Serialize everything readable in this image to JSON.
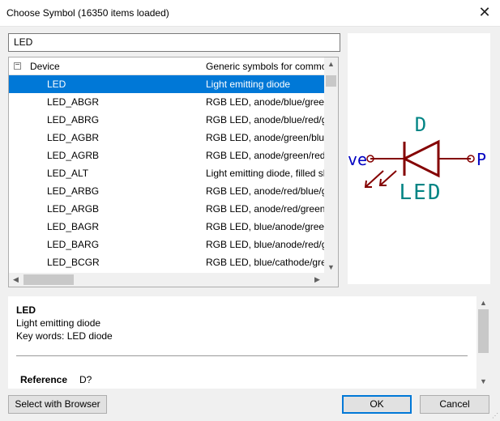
{
  "window": {
    "title": "Choose Symbol (16350 items loaded)"
  },
  "filter": {
    "value": "LED"
  },
  "tree": {
    "group": {
      "name": "Device",
      "description": "Generic symbols for common devices"
    },
    "rows": [
      {
        "name": "LED",
        "description": "Light emitting diode",
        "selected": true
      },
      {
        "name": "LED_ABGR",
        "description": "RGB LED, anode/blue/green/red"
      },
      {
        "name": "LED_ABRG",
        "description": "RGB LED, anode/blue/red/green"
      },
      {
        "name": "LED_AGBR",
        "description": "RGB LED, anode/green/blue/red"
      },
      {
        "name": "LED_AGRB",
        "description": "RGB LED, anode/green/red/blue"
      },
      {
        "name": "LED_ALT",
        "description": "Light emitting diode, filled shape"
      },
      {
        "name": "LED_ARBG",
        "description": "RGB LED, anode/red/blue/green"
      },
      {
        "name": "LED_ARGB",
        "description": "RGB LED, anode/red/green/blue"
      },
      {
        "name": "LED_BAGR",
        "description": "RGB LED, blue/anode/green/red"
      },
      {
        "name": "LED_BARG",
        "description": "RGB LED, blue/anode/red/green"
      },
      {
        "name": "LED_BCGR",
        "description": "RGB LED, blue/cathode/green/red"
      }
    ]
  },
  "preview": {
    "ref": "D",
    "value": "LED",
    "pin_left": "ve",
    "pin_right": "P",
    "body_color": "#840000",
    "text_color": "#008484",
    "pin_text_color": "#0000c2"
  },
  "details": {
    "name": "LED",
    "description": "Light emitting diode",
    "keywords": "Key words: LED diode",
    "reference_label": "Reference",
    "reference_value": "D?"
  },
  "buttons": {
    "browser": "Select with Browser",
    "ok": "OK",
    "cancel": "Cancel"
  },
  "colors": {
    "selection": "#0078d7"
  }
}
